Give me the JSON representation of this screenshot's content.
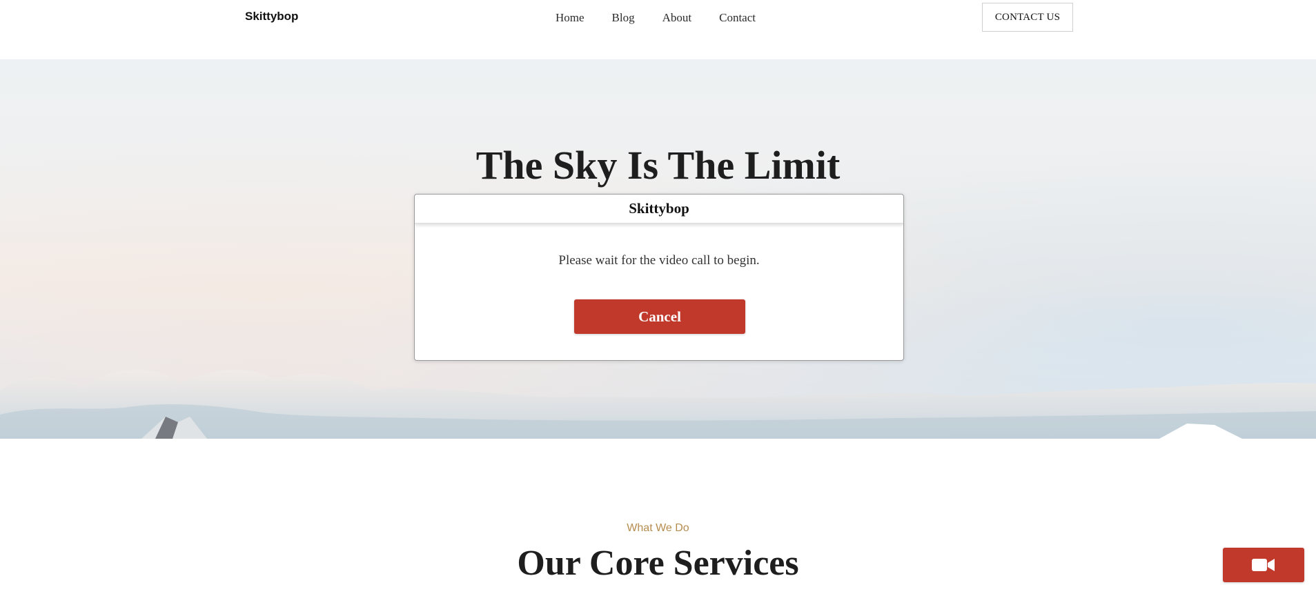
{
  "header": {
    "brand": "Skittybop",
    "nav": [
      {
        "label": "Home"
      },
      {
        "label": "Blog"
      },
      {
        "label": "About"
      },
      {
        "label": "Contact"
      }
    ],
    "cta_label": "CONTACT US"
  },
  "hero": {
    "title": "The Sky Is The Limit"
  },
  "modal": {
    "title": "Skittybop",
    "message": "Please wait for the video call to begin.",
    "cancel_label": "Cancel"
  },
  "services": {
    "eyebrow": "What We Do",
    "title": "Our Core Services"
  },
  "video_button": {
    "icon": "video-camera-icon"
  },
  "colors": {
    "accent": "#c0392b",
    "eyebrow": "#b58c4e"
  }
}
